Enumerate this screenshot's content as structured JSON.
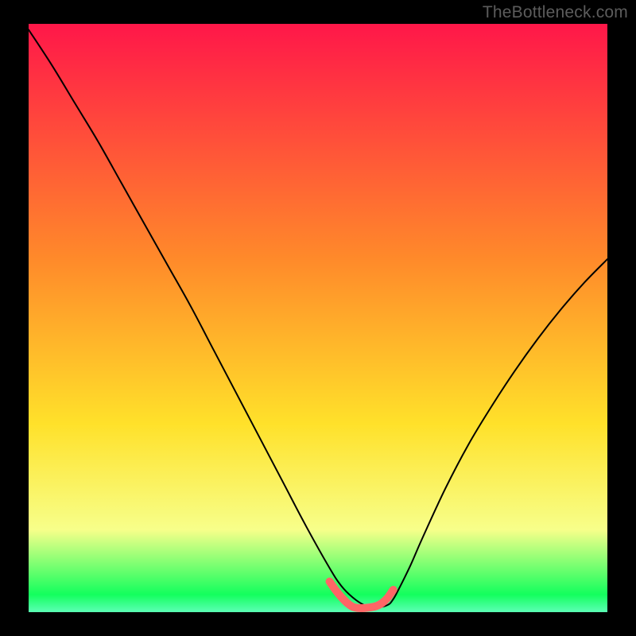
{
  "watermark": "TheBottleneck.com",
  "gradient_colors": {
    "top": "#ff1749",
    "orange": "#ff8a2a",
    "yellow": "#ffe12a",
    "pale": "#f7ff8a",
    "green": "#13ff5d",
    "mint": "#5cffb5"
  },
  "chart_data": {
    "type": "line",
    "title": "",
    "xlabel": "",
    "ylabel": "",
    "xlim": [
      0,
      100
    ],
    "ylim": [
      0,
      100
    ],
    "series": [
      {
        "name": "bottleneck-curve",
        "color": "#000000",
        "x": [
          0,
          4,
          8,
          12,
          16,
          20,
          24,
          28,
          32,
          36,
          40,
          44,
          48,
          52,
          54,
          56,
          58,
          60,
          62,
          63,
          64,
          66,
          68,
          72,
          76,
          80,
          84,
          88,
          92,
          96,
          100
        ],
        "y": [
          99,
          93,
          86.5,
          80,
          73,
          66,
          59,
          52,
          44.5,
          37,
          29.5,
          22,
          14.5,
          7.5,
          4.5,
          2.5,
          1.2,
          0.8,
          1.2,
          2.2,
          4,
          8,
          12.5,
          21,
          28.5,
          35,
          41,
          46.5,
          51.5,
          56,
          60
        ]
      },
      {
        "name": "flat-bottom-marker",
        "color": "#ff6666",
        "thick": true,
        "x": [
          52,
          53,
          54,
          55,
          56,
          57,
          58,
          59,
          60,
          61,
          62,
          63
        ],
        "y": [
          5.2,
          3.8,
          2.6,
          1.6,
          0.9,
          0.7,
          0.7,
          0.8,
          1.0,
          1.5,
          2.4,
          3.8
        ]
      }
    ]
  }
}
